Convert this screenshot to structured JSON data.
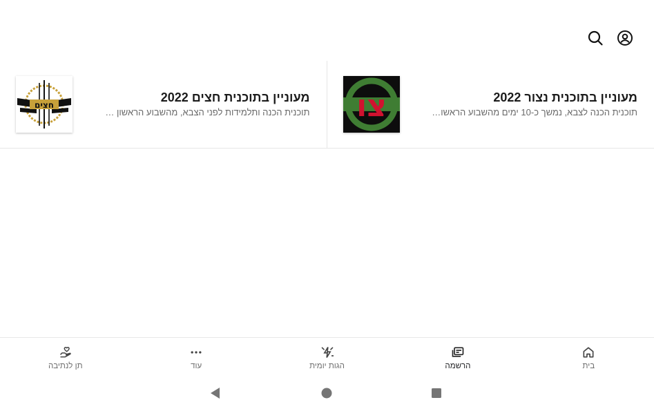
{
  "header": {
    "account_icon": "account-circle-icon",
    "search_icon": "search-icon"
  },
  "cards": [
    {
      "title": "מעוניין בתוכנית נצור 2022",
      "subtitle": "תוכנית הכנה לצבא, נמשך כ-10 ימים מהשבוע הראשון ...",
      "logo_text": "צו",
      "logo_bg": "#0d0d0d",
      "logo_accent": "#d0122f",
      "logo_ring": "#3f7d33"
    },
    {
      "title": "מעוניין בתוכנית חצים 2022",
      "subtitle": "תוכנית הכנה ותלמידות לפני הצבא, מהשבוע הראשון ש...",
      "logo_text": "חצים",
      "logo_gold": "#c8a13a",
      "logo_dark": "#111111"
    }
  ],
  "bottom_nav": [
    {
      "label": "בית",
      "icon": "home-icon"
    },
    {
      "label": "הרשמה",
      "icon": "registration-icon"
    },
    {
      "label": "הגות יומית",
      "icon": "daily-thought-icon"
    },
    {
      "label": "עוד",
      "icon": "more-icon"
    },
    {
      "label": "תן לנתיבה",
      "icon": "donate-heart-hand-icon"
    }
  ],
  "colors": {
    "text_primary": "#1b1b1b",
    "text_secondary": "#6a6a6a",
    "divider": "#e6e6e6",
    "system_nav": "#757575"
  }
}
